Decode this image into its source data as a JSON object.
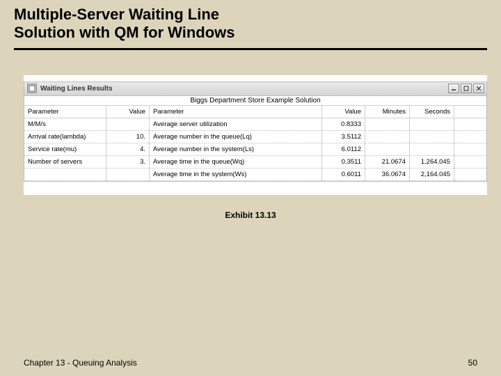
{
  "slide": {
    "title_line1": "Multiple-Server Waiting Line",
    "title_line2": "Solution with QM for Windows",
    "exhibit_label": "Exhibit 13.13",
    "footer_left": "Chapter 13 - Queuing Analysis",
    "footer_right": "50"
  },
  "window": {
    "title": "Waiting Lines Results",
    "caption": "Biggs Department Store Example Solution",
    "headers": {
      "param1": "Parameter",
      "value1": "Value",
      "param2": "Parameter",
      "value2": "Value",
      "minutes": "Minutes",
      "seconds": "Seconds"
    },
    "left_rows": [
      {
        "param": "M/M/s",
        "value": ""
      },
      {
        "param": "Arrival rate(lambda)",
        "value": "10."
      },
      {
        "param": "Service rate(mu)",
        "value": "4."
      },
      {
        "param": "Number of servers",
        "value": "3."
      },
      {
        "param": "",
        "value": ""
      }
    ],
    "right_rows": [
      {
        "param": "Average server utilization",
        "value": "0.8333",
        "minutes": "",
        "seconds": ""
      },
      {
        "param": "Average number in the queue(Lq)",
        "value": "3.5112",
        "minutes": "",
        "seconds": ""
      },
      {
        "param": "Average number in the system(Ls)",
        "value": "6.0112",
        "minutes": "",
        "seconds": ""
      },
      {
        "param": "Average time in the queue(Wq)",
        "value": "0.3511",
        "minutes": "21.0674",
        "seconds": "1,264.045"
      },
      {
        "param": "Average time in the system(Ws)",
        "value": "0.6011",
        "minutes": "36.0674",
        "seconds": "2,164.045"
      }
    ]
  }
}
